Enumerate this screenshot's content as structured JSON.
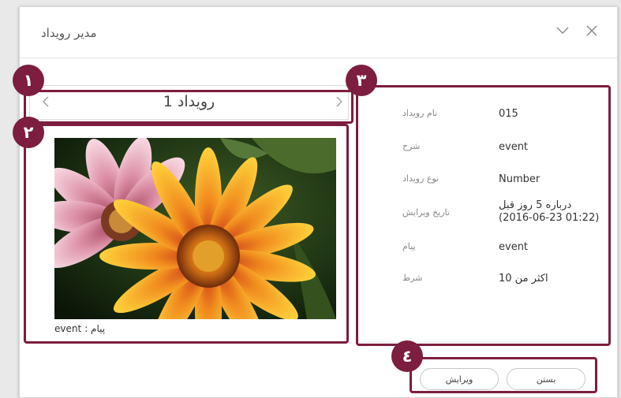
{
  "dialog": {
    "title": "مدیر رویداد"
  },
  "icons": {
    "collapse": "chevron-down-icon",
    "close": "close-icon",
    "prev": "chevron-left-icon",
    "next": "chevron-right-icon"
  },
  "markers": [
    "١",
    "٢",
    "٣",
    "٤"
  ],
  "event_nav": {
    "title": "رویداد 1"
  },
  "image": {
    "caption_label": "پیام :",
    "caption_value": "event"
  },
  "details": [
    {
      "label": "نام رویداد",
      "value": "015"
    },
    {
      "label": "شرح",
      "value": "event"
    },
    {
      "label": "نوع رویداد",
      "value": "Number"
    },
    {
      "label": "تاریخ ویرایش",
      "value": "درباره 5 روز قبل",
      "value2": "(2016-06-23 01:22)"
    },
    {
      "label": "پیام",
      "value": "event"
    },
    {
      "label": "شرط",
      "value": "اکثر من 10"
    }
  ],
  "buttons": {
    "edit": "ویرایش",
    "close": "بستن"
  },
  "colors": {
    "marker": "#7d1d3f",
    "background": "#ffffff"
  }
}
